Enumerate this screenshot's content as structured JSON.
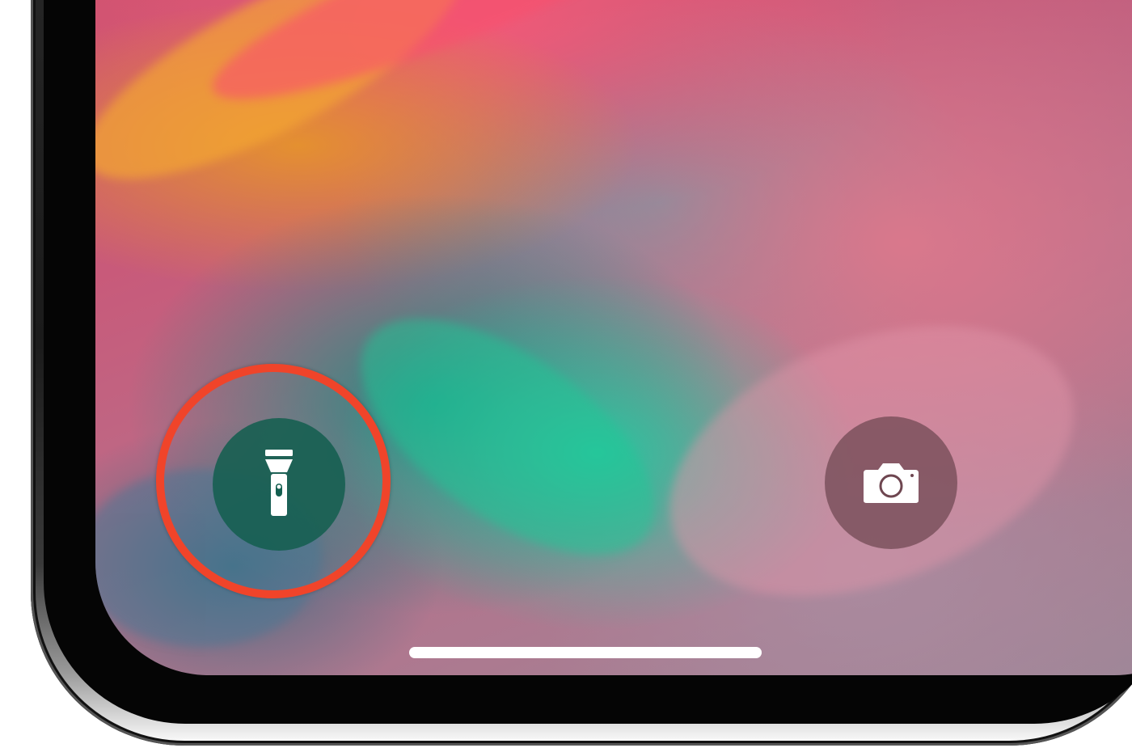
{
  "device": {
    "frame_color": "#1b1b1b",
    "bezel_color": "#050505",
    "steel_color": "#d9d9d9"
  },
  "lock_screen": {
    "wallpaper": "abstract-paint-swirl",
    "flashlight_button": {
      "icon": "flashlight-icon",
      "state": "off",
      "background": "#145f50"
    },
    "camera_button": {
      "icon": "camera-icon",
      "background": "#6e4650"
    },
    "home_indicator": {
      "color": "#ffffff"
    }
  },
  "annotation": {
    "type": "circle-highlight",
    "target": "flashlight_button",
    "color": "#f0442a"
  }
}
